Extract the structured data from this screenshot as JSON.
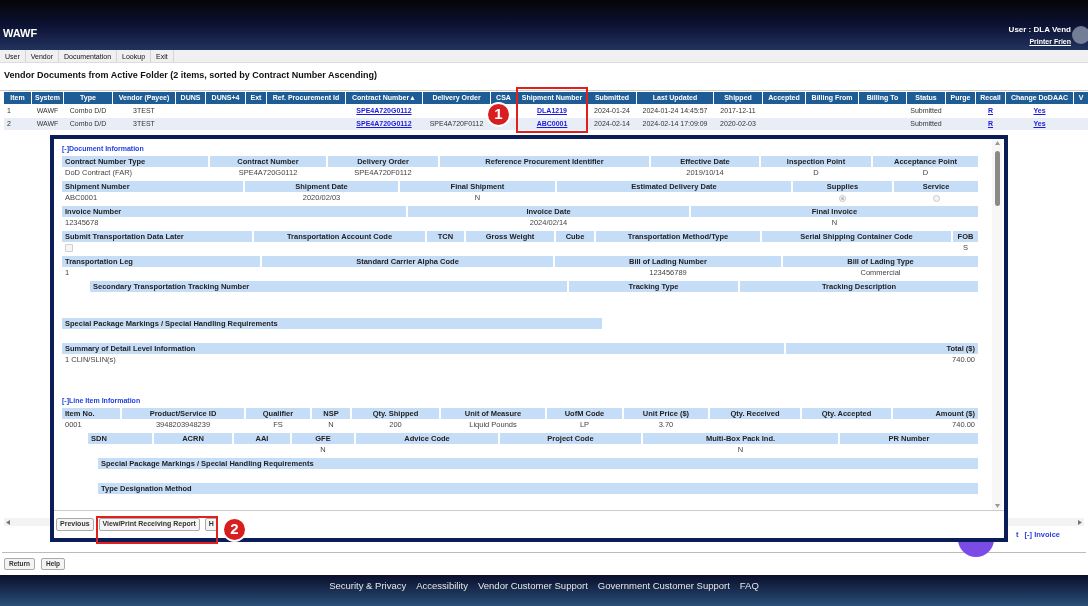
{
  "header": {
    "app_title": "WAWF",
    "user": "User : DLA Vend",
    "printer_link": "Printer Frien"
  },
  "menu": [
    "User",
    "Vendor",
    "Documentation",
    "Lookup",
    "Exit"
  ],
  "page_title": "Vendor Documents from Active Folder (2 items, sorted by Contract Number Ascending)",
  "documents_table": {
    "columns": [
      "Item",
      "System",
      "Type",
      "Vendor (Payee)",
      "DUNS",
      "DUNS+4",
      "Ext",
      "Ref. Procurement Id",
      "Contract Number▲",
      "Delivery Order",
      "CSA",
      "Shipment Number",
      "Submitted",
      "Last Updated",
      "Shipped",
      "Accepted",
      "Billing From",
      "Billing To",
      "Status",
      "Purge",
      "Recall",
      "Change DoDAAC",
      "V"
    ],
    "rows": [
      {
        "item": "1",
        "system": "WAWF",
        "type": "Combo D/D",
        "vendor": "3TEST",
        "contract_number": "SPE4A720G0112",
        "shipment_number": "DLA1219",
        "submitted": "2024-01-24",
        "last_updated": "2024-01-24 14:45:57",
        "shipped": "2017-12-11",
        "status": "Submitted",
        "recall": "R",
        "change_dodaac": "Yes"
      },
      {
        "item": "2",
        "system": "WAWF",
        "type": "Combo D/D",
        "vendor": "3TEST",
        "contract_number": "SPE4A720G0112",
        "delivery_order": "SPE4A720F0112",
        "shipment_number": "ABC0001",
        "submitted": "2024-02-14",
        "last_updated": "2024-02-14 17:09:09",
        "shipped": "2020-02-03",
        "status": "Submitted",
        "recall": "R",
        "change_dodaac": "Yes"
      }
    ]
  },
  "detail_dialog": {
    "sections": [
      {
        "toggle": "[-]Document Information",
        "rows": [
          {
            "fields": [
              {
                "kind": "text",
                "label": "Contract Number Type",
                "value": "DoD Contract (FAR)"
              },
              {
                "kind": "text",
                "label": "Contract Number",
                "value": "SPE4A720G0112"
              },
              {
                "kind": "text",
                "label": "Delivery Order",
                "value": "SPE4A720F0112"
              },
              {
                "kind": "text",
                "label": "Reference Procurement Identifier"
              },
              {
                "kind": "text",
                "label": "Effective Date",
                "value": "2019/10/14"
              },
              {
                "kind": "text",
                "label": "Inspection Point",
                "value": "D"
              },
              {
                "kind": "text",
                "label": "Acceptance Point",
                "value": "D"
              }
            ]
          },
          {
            "fields": [
              {
                "kind": "text",
                "label": "Shipment Number",
                "value": "ABC0001"
              },
              {
                "kind": "text",
                "label": "Shipment Date",
                "value": "2020/02/03"
              },
              {
                "kind": "text",
                "label": "Final Shipment",
                "value": "N"
              },
              {
                "kind": "text",
                "label": "Estimated Delivery Date"
              },
              {
                "kind": "radio",
                "label": "Supplies",
                "selected": true
              },
              {
                "kind": "radio",
                "label": "Service",
                "selected": false
              }
            ]
          },
          {
            "fields": [
              {
                "kind": "text",
                "label": "Invoice Number",
                "value": "12345678"
              },
              {
                "kind": "text",
                "label": "Invoice Date",
                "value": "2024/02/14"
              },
              {
                "kind": "text",
                "label": "Final Invoice",
                "value": "N"
              }
            ]
          },
          {
            "fields": [
              {
                "kind": "checkbox",
                "label": "Submit Transportation Data Later",
                "checked": false
              },
              {
                "kind": "text",
                "label": "Transportation Account Code"
              },
              {
                "kind": "text",
                "label": "TCN"
              },
              {
                "kind": "text",
                "label": "Gross Weight"
              },
              {
                "kind": "text",
                "label": "Cube"
              },
              {
                "kind": "text",
                "label": "Transportation Method/Type"
              },
              {
                "kind": "text",
                "label": "Serial Shipping Container Code"
              },
              {
                "kind": "text",
                "label": "FOB",
                "value": "S"
              }
            ]
          },
          {
            "fields": [
              {
                "kind": "text",
                "label": "Transportation Leg",
                "value": "1"
              },
              {
                "kind": "text",
                "label": "Standard Carrier Alpha Code"
              },
              {
                "kind": "text",
                "label": "Bill of Lading Number",
                "value": "123456789"
              },
              {
                "kind": "text",
                "label": "Bill of Lading Type",
                "value": "Commercial"
              }
            ]
          },
          {
            "fields": [
              {
                "kind": "text",
                "label": "Secondary Transportation Tracking Number"
              },
              {
                "kind": "text",
                "label": "Tracking Type"
              },
              {
                "kind": "text",
                "label": "Tracking Description"
              }
            ]
          },
          {
            "fields": [
              {
                "kind": "text",
                "label": "Special Package Markings / Special Handling Requirements"
              }
            ]
          },
          {
            "fields": [
              {
                "kind": "text",
                "label": "Summary of Detail Level Information",
                "value": "1 CLIN/SLIN(s)"
              },
              {
                "kind": "text",
                "label": "Total ($)",
                "value": "740.00"
              }
            ]
          }
        ]
      },
      {
        "toggle": "[-]Line Item Information",
        "rows": [
          {
            "fields": [
              {
                "kind": "text",
                "label": "Item No.",
                "value": "0001"
              },
              {
                "kind": "text",
                "label": "Product/Service ID",
                "value": "3948203948239"
              },
              {
                "kind": "text",
                "label": "Qualifier",
                "value": "FS"
              },
              {
                "kind": "text",
                "label": "NSP",
                "value": "N"
              },
              {
                "kind": "text",
                "label": "Qty. Shipped",
                "value": "200"
              },
              {
                "kind": "text",
                "label": "Unit of Measure",
                "value": "Liquid Pounds"
              },
              {
                "kind": "text",
                "label": "UofM Code",
                "value": "LP"
              },
              {
                "kind": "text",
                "label": "Unit Price ($)",
                "value": "3.70"
              },
              {
                "kind": "text",
                "label": "Qty. Received"
              },
              {
                "kind": "text",
                "label": "Qty. Accepted"
              },
              {
                "kind": "text",
                "label": "Amount ($)",
                "value": "740.00"
              }
            ]
          },
          {
            "fields": [
              {
                "kind": "text",
                "label": "SDN"
              },
              {
                "kind": "text",
                "label": "ACRN"
              },
              {
                "kind": "text",
                "label": "AAI"
              },
              {
                "kind": "text",
                "label": "GFE",
                "value": "N"
              },
              {
                "kind": "text",
                "label": "Advice Code"
              },
              {
                "kind": "text",
                "label": "Project Code"
              },
              {
                "kind": "text",
                "label": "Multi-Box Pack Ind.",
                "value": "N"
              },
              {
                "kind": "text",
                "label": "PR Number"
              }
            ]
          },
          {
            "fields": [
              {
                "kind": "text",
                "label": "Special Package Markings / Special Handling Requirements"
              }
            ]
          },
          {
            "fields": [
              {
                "kind": "text",
                "label": "Type Designation Method"
              }
            ]
          }
        ]
      }
    ],
    "buttons": [
      "Previous",
      "View/Print Receiving Report",
      "H"
    ]
  },
  "behind_dialog": {
    "partial_link": "t",
    "invoice_link": "[-] Invoice"
  },
  "page_buttons": [
    "Return",
    "Help"
  ],
  "footer_links": [
    "Security & Privacy",
    "Accessibility",
    "Vendor Customer Support",
    "Government Customer Support",
    "FAQ"
  ],
  "annotations": [
    {
      "number": "1"
    },
    {
      "number": "2"
    }
  ]
}
